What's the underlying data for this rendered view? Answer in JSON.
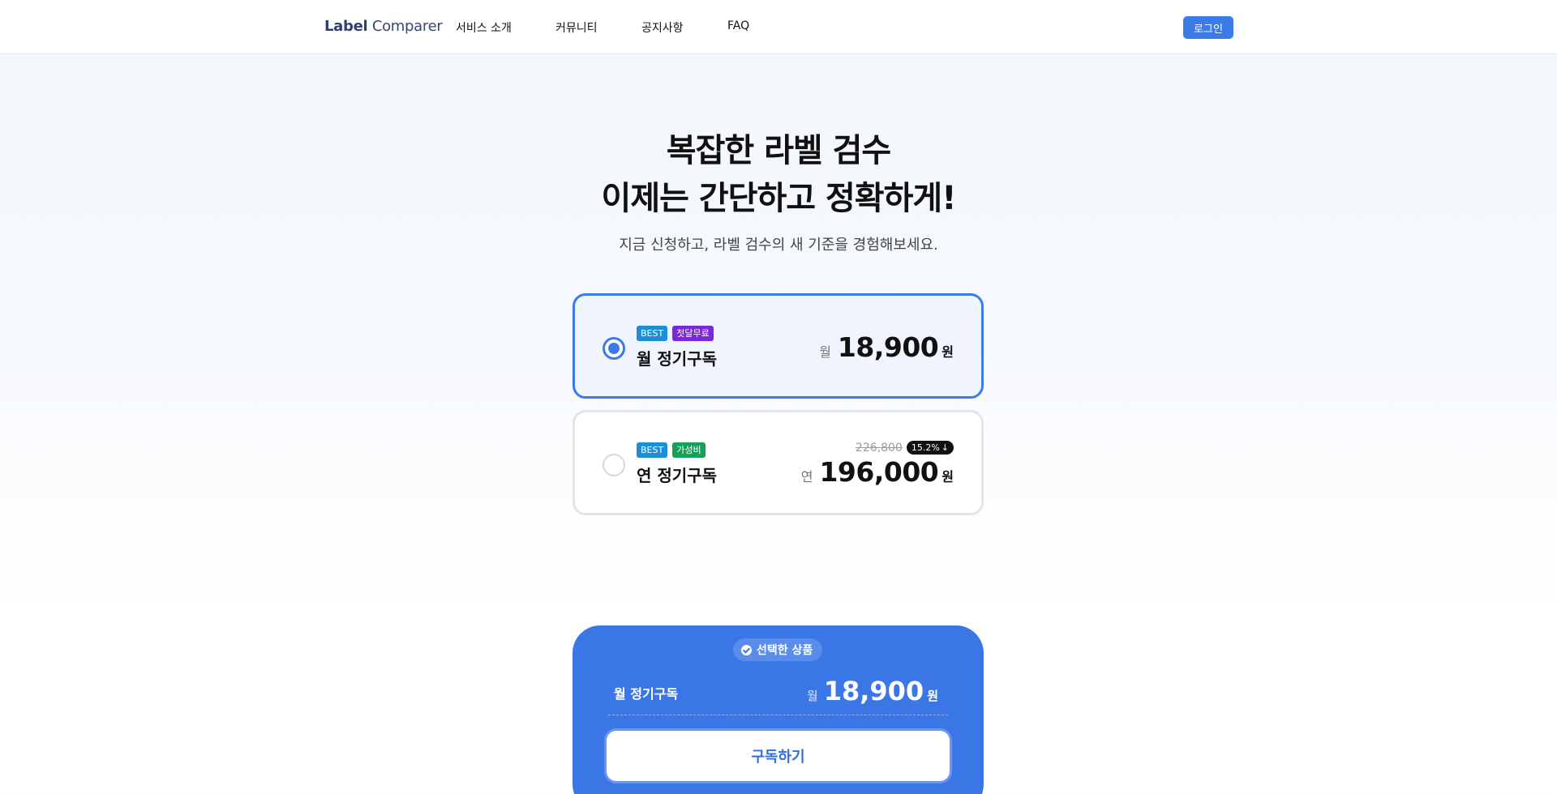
{
  "header": {
    "logo_bold": "Label",
    "logo_light": "Comparer",
    "nav": [
      "서비스 소개",
      "커뮤니티",
      "공지사항",
      "FAQ"
    ],
    "login_label": "로그인"
  },
  "hero": {
    "title_line1": "복잡한 라벨 검수",
    "title_line2": "이제는 간단하고 정확하게!",
    "subtitle": "지금 신청하고, 라벨 검수의 새 기준을 경험해보세요."
  },
  "plans": [
    {
      "name": "월 정기구독",
      "badges": [
        "BEST",
        "첫달무료"
      ],
      "period_prefix": "월",
      "price": "18,900",
      "currency": "원",
      "selected": true
    },
    {
      "name": "연 정기구독",
      "badges": [
        "BEST",
        "가성비"
      ],
      "period_prefix": "연",
      "price": "196,000",
      "currency": "원",
      "original_price": "226,800",
      "discount": "15.2%",
      "selected": false
    }
  ],
  "selected_panel": {
    "chip_label": "선택한 상품",
    "plan_name": "월 정기구독",
    "period_prefix": "월",
    "price": "18,900",
    "currency": "원",
    "subscribe_label": "구독하기"
  },
  "colors": {
    "accent": "#3b7be8",
    "panel": "#3b76e6",
    "badge_best": "#1b8fd6",
    "badge_free": "#7a29d6",
    "badge_value": "#16a05a"
  }
}
